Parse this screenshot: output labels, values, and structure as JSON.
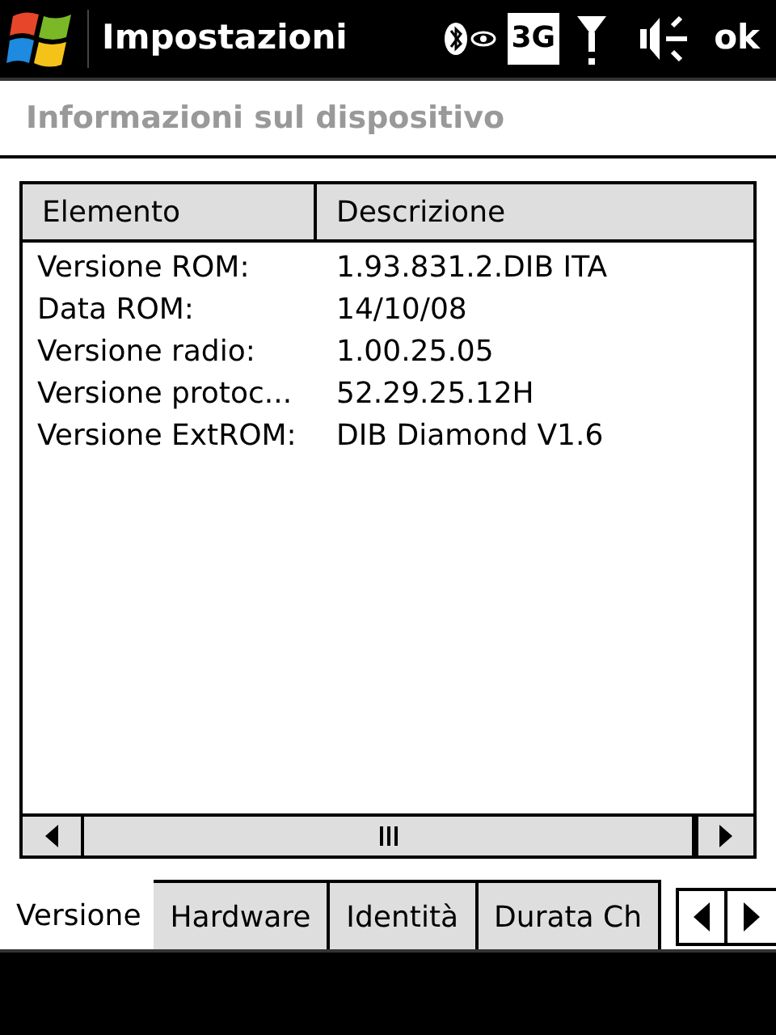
{
  "top_bar": {
    "title": "Impostazioni",
    "network_badge": "3G",
    "ok_button": "ok"
  },
  "page_title": "Informazioni sul dispositivo",
  "table": {
    "columns": [
      "Elemento",
      "Descrizione"
    ],
    "rows": [
      [
        "Versione ROM:",
        "1.93.831.2.DIB ITA"
      ],
      [
        "Data ROM:",
        "14/10/08"
      ],
      [
        "Versione radio:",
        "1.00.25.05"
      ],
      [
        "Versione protoc...",
        "52.29.25.12H"
      ],
      [
        "Versione ExtROM:",
        "DIB Diamond V1.6"
      ]
    ]
  },
  "tabs": [
    {
      "label": "Versione",
      "selected": true
    },
    {
      "label": "Hardware",
      "selected": false
    },
    {
      "label": "Identità",
      "selected": false
    },
    {
      "label": "Durata Ch",
      "selected": false
    }
  ]
}
